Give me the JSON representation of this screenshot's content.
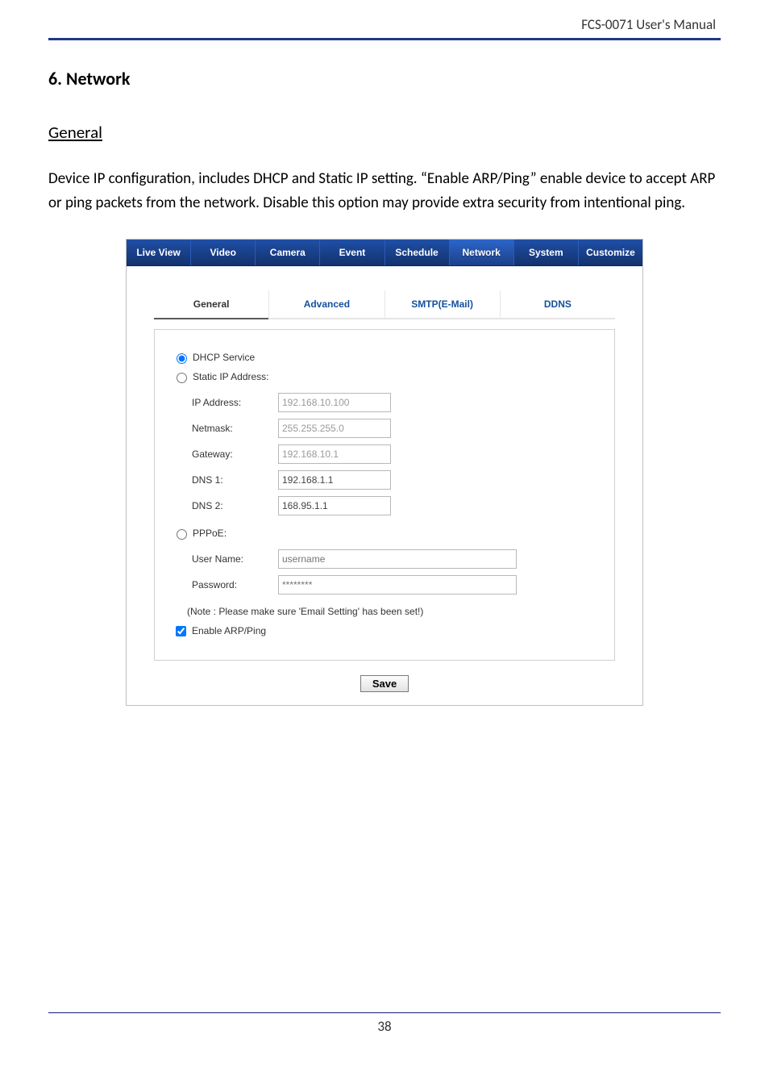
{
  "header": {
    "doc_title": "FCS-0071 User's Manual"
  },
  "section": {
    "title": "6. Network"
  },
  "sub": {
    "title": "General"
  },
  "body": {
    "para": "Device IP configuration, includes DHCP and Static IP setting. “Enable ARP/Ping” enable device to accept ARP or ping packets from the network. Disable this option may provide extra security from intentional ping."
  },
  "mainnav": {
    "items": [
      "Live View",
      "Video",
      "Camera",
      "Event",
      "Schedule",
      "Network",
      "System",
      "Customize"
    ],
    "selected_index": 5
  },
  "subnav": {
    "items": [
      "General",
      "Advanced",
      "SMTP(E-Mail)",
      "DDNS"
    ],
    "active_index": 0
  },
  "form": {
    "radios": {
      "dhcp_label": "DHCP Service",
      "static_label": "Static IP Address:",
      "pppoe_label": "PPPoE:",
      "selected": "dhcp"
    },
    "fields": {
      "ip_label": "IP Address:",
      "ip_value": "192.168.10.100",
      "nm_label": "Netmask:",
      "nm_value": "255.255.255.0",
      "gw_label": "Gateway:",
      "gw_value": "192.168.10.1",
      "dns1_label": "DNS 1:",
      "dns1_value": "192.168.1.1",
      "dns2_label": "DNS 2:",
      "dns2_value": "168.95.1.1",
      "user_label": "User Name:",
      "user_placeholder": "username",
      "user_value": "",
      "pass_label": "Password:",
      "pass_placeholder": "********",
      "pass_value": ""
    },
    "note": "(Note : Please make sure 'Email Setting' has been set!)",
    "arp_label": "Enable ARP/Ping",
    "arp_checked": true,
    "save_label": "Save"
  },
  "footer": {
    "page_number": "38"
  }
}
